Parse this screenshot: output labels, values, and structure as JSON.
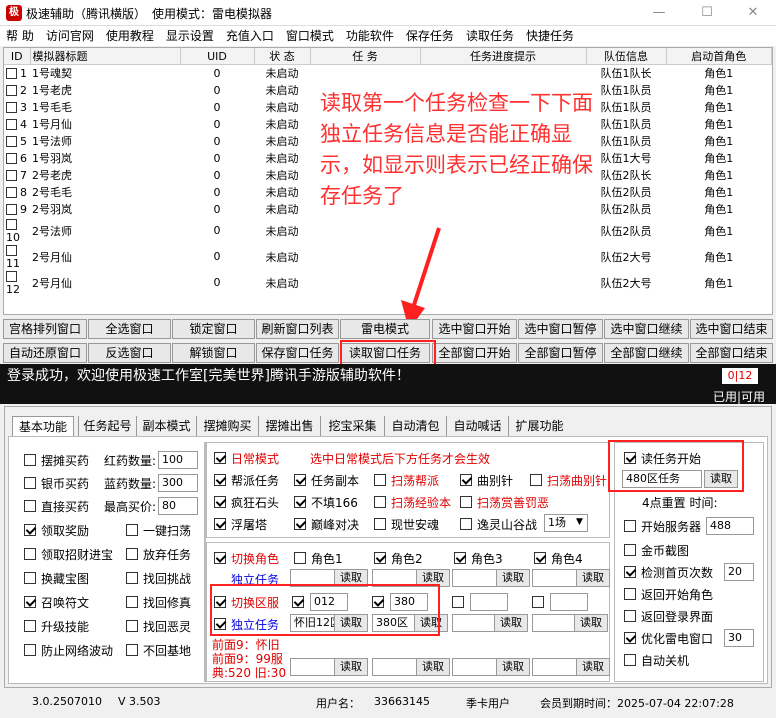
{
  "window": {
    "title": "极速辅助（腾讯横版）",
    "mode_label": "使用模式：雷电模拟器",
    "minimize": "—",
    "maximize": "☐",
    "close": "✕"
  },
  "menu": [
    "帮 助",
    "访问官网",
    "使用教程",
    "显示设置",
    "充值入口",
    "窗口模式",
    "功能软件",
    "保存任务",
    "读取任务",
    "快捷任务"
  ],
  "table": {
    "headers": [
      "ID",
      "模拟器标题",
      "UID",
      "状 态",
      "任 务",
      "任务进度提示",
      "队伍信息",
      "启动首角色"
    ],
    "rows": [
      [
        "1",
        "1号魂契",
        "0",
        "未启动",
        "",
        "",
        "队伍1队长",
        "角色1"
      ],
      [
        "2",
        "1号老虎",
        "0",
        "未启动",
        "",
        "",
        "队伍1队员",
        "角色1"
      ],
      [
        "3",
        "1号毛毛",
        "0",
        "未启动",
        "",
        "",
        "队伍1队员",
        "角色1"
      ],
      [
        "4",
        "1号月仙",
        "0",
        "未启动",
        "",
        "",
        "队伍1队员",
        "角色1"
      ],
      [
        "5",
        "1号法师",
        "0",
        "未启动",
        "",
        "",
        "队伍1队员",
        "角色1"
      ],
      [
        "6",
        "1号羽岚",
        "0",
        "未启动",
        "",
        "",
        "队伍1大号",
        "角色1"
      ],
      [
        "7",
        "2号老虎",
        "0",
        "未启动",
        "",
        "",
        "队伍2队长",
        "角色1"
      ],
      [
        "8",
        "2号毛毛",
        "0",
        "未启动",
        "",
        "",
        "队伍2队员",
        "角色1"
      ],
      [
        "9",
        "2号羽岚",
        "0",
        "未启动",
        "",
        "",
        "队伍2队员",
        "角色1"
      ],
      [
        "10",
        "2号法师",
        "0",
        "未启动",
        "",
        "",
        "队伍2队员",
        "角色1"
      ],
      [
        "11",
        "2号月仙",
        "0",
        "未启动",
        "",
        "",
        "队伍2大号",
        "角色1"
      ],
      [
        "12",
        "2号月仙",
        "0",
        "未启动",
        "",
        "",
        "队伍2大号",
        "角色1"
      ]
    ]
  },
  "annotation": "读取第一个任务检查一下下面独立任务信息是否能正确显示，如显示则表示已经正确保存任务了",
  "buttons_row1": [
    "宫格排列窗口",
    "全选窗口",
    "锁定窗口",
    "刷新窗口列表",
    "雷电模式",
    "选中窗口开始",
    "选中窗口暂停",
    "选中窗口继续",
    "选中窗口结束"
  ],
  "buttons_row2": [
    "自动还原窗口",
    "反选窗口",
    "解锁窗口",
    "保存窗口任务",
    "读取窗口任务",
    "全部窗口开始",
    "全部窗口暂停",
    "全部窗口继续",
    "全部窗口结束"
  ],
  "status": {
    "message": "登录成功，欢迎使用极速工作室[完美世界]腾讯手游版辅助软件！",
    "count": "0|12",
    "avail": "已用|可用"
  },
  "tabs": [
    "基本功能",
    "任务起号",
    "副本模式",
    "摆摊购买",
    "摆摊出售",
    "挖宝采集",
    "自动清包",
    "自动喊话",
    "扩展功能"
  ],
  "left": {
    "items": [
      {
        "label": "摆摊买药",
        "on": false
      },
      {
        "label": "银币买药",
        "on": false
      },
      {
        "label": "直接买药",
        "on": false
      },
      {
        "label": "领取奖励",
        "on": true
      },
      {
        "label": "领取招财进宝",
        "on": false
      },
      {
        "label": "换藏宝图",
        "on": false
      },
      {
        "label": "召唤符文",
        "on": true
      },
      {
        "label": "升级技能",
        "on": false
      },
      {
        "label": "防止网络波动",
        "on": false
      }
    ],
    "red_qty_label": "红药数量:",
    "red_qty": "100",
    "blue_qty_label": "蓝药数量:",
    "blue_qty": "300",
    "max_price_label": "最高买价:",
    "max_price": "80",
    "right_items": [
      {
        "label": "一键扫荡",
        "on": false
      },
      {
        "label": "放弃任务",
        "on": false
      },
      {
        "label": "找回挑战",
        "on": false
      },
      {
        "label": "找回修真",
        "on": false
      },
      {
        "label": "找回恶灵",
        "on": false
      },
      {
        "label": "不回基地",
        "on": false
      }
    ]
  },
  "mid": {
    "daily_mode": "日常模式",
    "daily_hint": "选中日常模式后下方任务才会生效",
    "row1": [
      {
        "label": "帮派任务",
        "on": true
      },
      {
        "label": "任务副本",
        "on": true
      },
      {
        "label": "扫荡帮派",
        "on": false
      },
      {
        "label": "曲别针",
        "on": true
      },
      {
        "label": "扫荡曲别针",
        "on": false
      }
    ],
    "row2": [
      {
        "label": "疯狂石头",
        "on": true
      },
      {
        "label": "不填166",
        "on": true
      },
      {
        "label": "扫荡经验本",
        "on": false
      },
      {
        "label": "扫荡赏善罚恶",
        "on": false
      }
    ],
    "row3": [
      {
        "label": "浮屠塔",
        "on": true
      },
      {
        "label": "巅峰对决",
        "on": true
      },
      {
        "label": "现世安魂",
        "on": false
      },
      {
        "label": "逸灵山谷战",
        "on": false
      }
    ],
    "round": "1场",
    "switch_role": "切换角色",
    "roles": [
      "角色1",
      "角色2",
      "角色3",
      "角色4"
    ],
    "independent": "独立任务",
    "read": "读取",
    "switch_server": "切换区服",
    "server1": "012",
    "server2": "380",
    "task1": "怀旧12区",
    "task2": "380区",
    "prev1": "前面9：怀旧",
    "prev2": "前面9：99服",
    "ready": "典:520 旧:30"
  },
  "right": {
    "read_start": "读任务开始",
    "read_value": "480区任务",
    "read_btn": "读取",
    "dots": "4点重置 时间:",
    "items": [
      {
        "label": "开始服务器",
        "on": false,
        "value": "488"
      },
      {
        "label": "金币截图",
        "on": false
      },
      {
        "label": "检测首页次数",
        "on": true,
        "value": "20"
      },
      {
        "label": "返回开始角色",
        "on": false
      },
      {
        "label": "返回登录界面",
        "on": false
      },
      {
        "label": "优化雷电窗口",
        "on": true,
        "value": "30"
      },
      {
        "label": "自动关机",
        "on": false
      }
    ]
  },
  "footer": {
    "version": "3.0.2507010",
    "v": "V 3.503",
    "user_label": "用户名：",
    "user": "33663145",
    "plan": "季卡用户",
    "expire": "会员到期时间：2025-07-04 22:07:28"
  }
}
